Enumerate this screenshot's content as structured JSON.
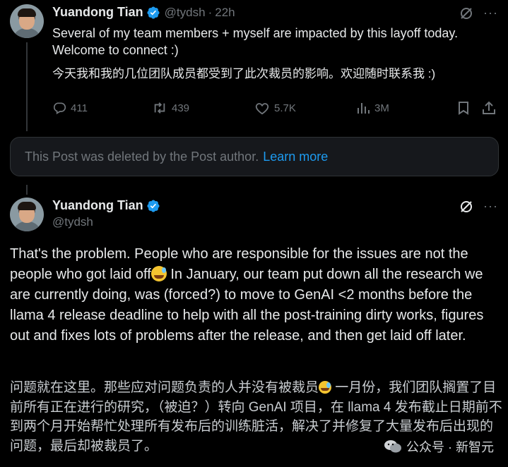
{
  "post1": {
    "author_name": "Yuandong Tian",
    "handle": "@tydsh",
    "dot": "·",
    "time": "22h",
    "text_en": "Several of my team members + myself are impacted by this layoff today. Welcome to connect :)",
    "text_zh": "今天我和我的几位团队成员都受到了此次裁员的影响。欢迎随时联系我 :)",
    "replies": "411",
    "reposts": "439",
    "likes": "5.7K",
    "views": "3M",
    "more": "···"
  },
  "deleted_notice": {
    "text": "This Post was deleted by the Post author.",
    "link": "Learn more"
  },
  "post2": {
    "author_name": "Yuandong Tian",
    "handle": "@tydsh",
    "more": "···",
    "text_en_1": "That's the problem. People who are responsible for the issues are not the people who got laid off",
    "text_en_2": " In January, our team put down all the research we are currently doing, was (forced?) to move to GenAI <2 months before the llama 4 release deadline to help with all the post-training dirty works, figures out and fixes lots of problems after the release, and then get laid off later.",
    "text_zh_1": "问题就在这里。那些应对问题负责的人并没有被裁员",
    "text_zh_2": " 一月份，我们团队搁置了目前所有正在进行的研究，（被迫？）转向 GenAI 项目，在 llama 4 发布截止日期前不到两个月开始帮忙处理所有发布后的训练脏活，解决了并修复了大量发布后出现的问题，最后却被裁员了。"
  },
  "watermark": {
    "text": "公众号 · 新智元"
  },
  "colors": {
    "background": "#000000",
    "text": "#e7e9ea",
    "muted": "#71767b",
    "link": "#1d9bf0",
    "verified": "#1d9bf0"
  }
}
